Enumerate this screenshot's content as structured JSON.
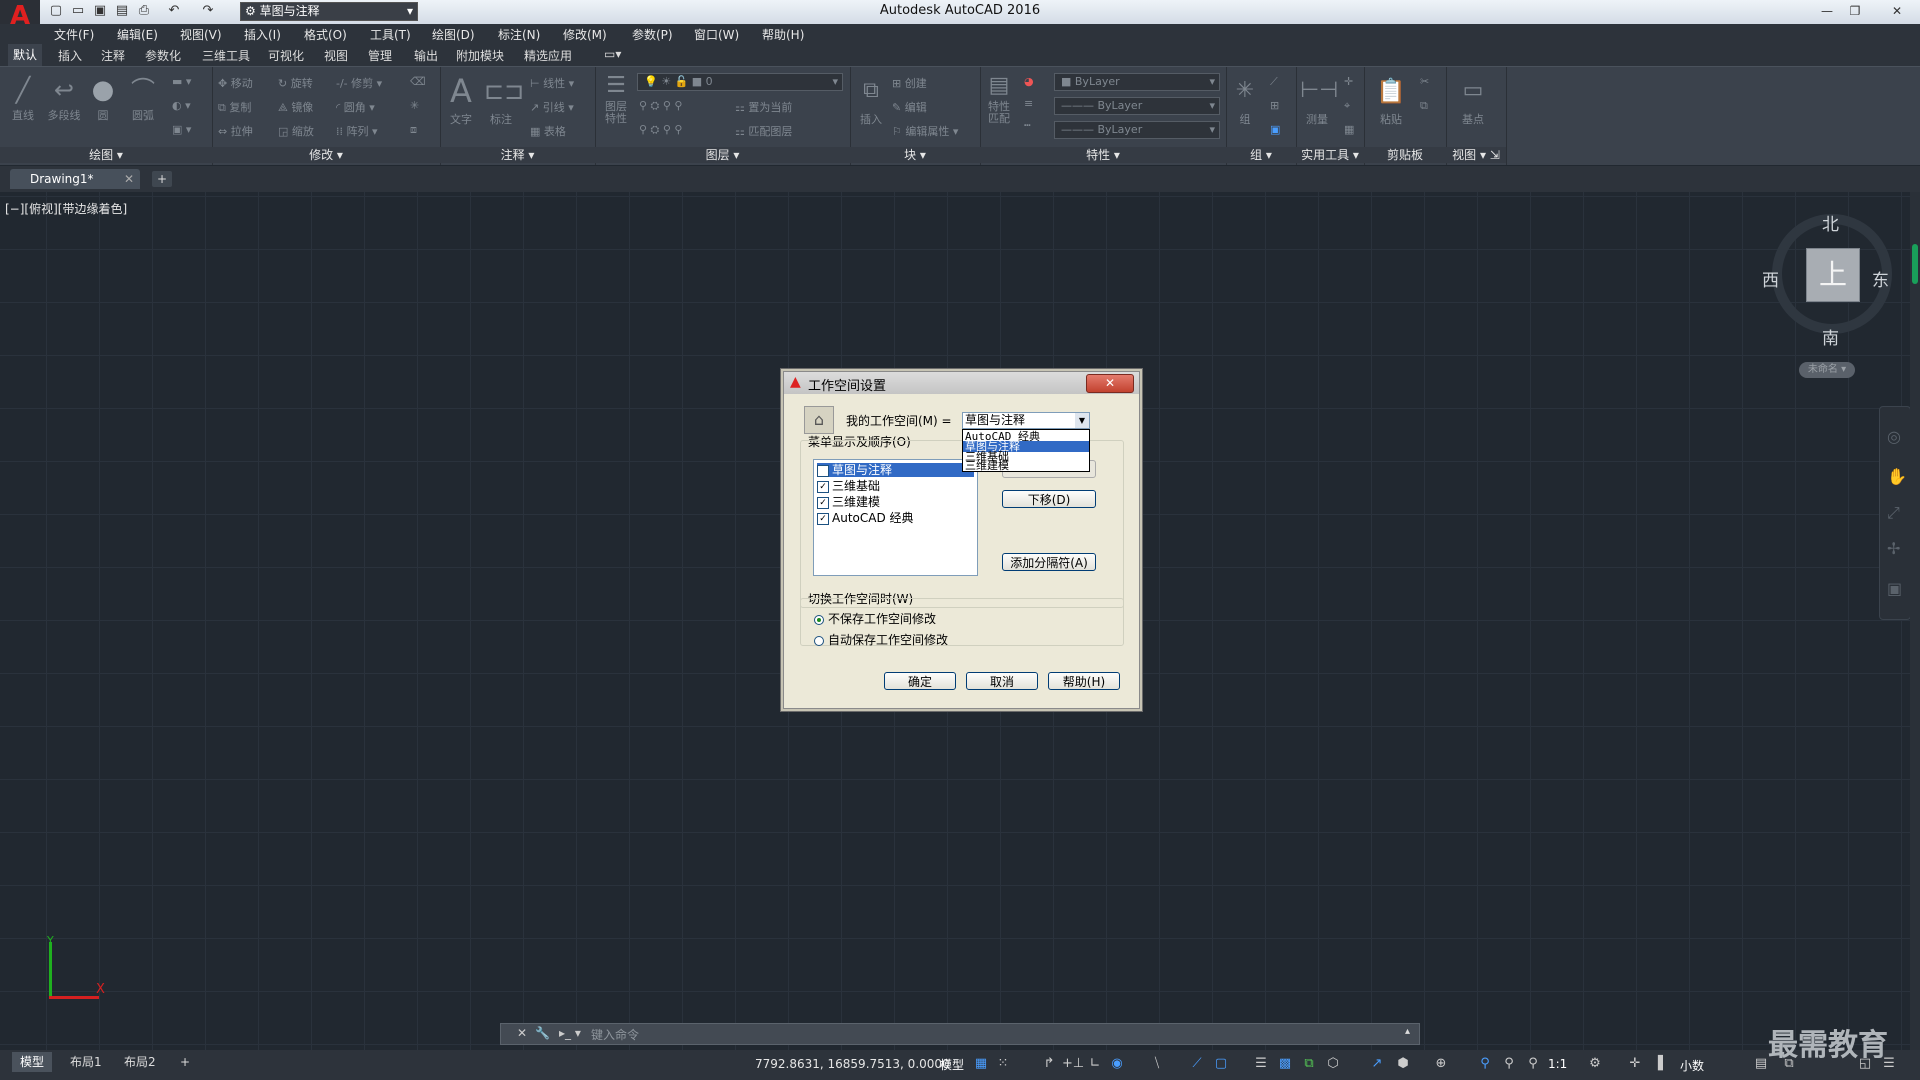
{
  "app": {
    "title": "Autodesk AutoCAD 2016",
    "workspace": "草图与注释",
    "logo_letter": "A"
  },
  "menubar": [
    "文件(F)",
    "编辑(E)",
    "视图(V)",
    "插入(I)",
    "格式(O)",
    "工具(T)",
    "绘图(D)",
    "标注(N)",
    "修改(M)",
    "参数(P)",
    "窗口(W)",
    "帮助(H)"
  ],
  "ribbon_tabs": [
    "默认",
    "插入",
    "注释",
    "参数化",
    "三维工具",
    "可视化",
    "视图",
    "管理",
    "输出",
    "附加模块",
    "精选应用"
  ],
  "ribbon": {
    "panels": [
      "绘图",
      "修改",
      "注释",
      "图层",
      "块",
      "特性",
      "组",
      "实用工具",
      "剪贴板",
      "视图"
    ],
    "draw_tools": [
      "直线",
      "多段线",
      "圆",
      "圆弧"
    ],
    "modify_tools": [
      "移动",
      "旋转",
      "修剪",
      "复制",
      "镜像",
      "圆角",
      "拉伸",
      "缩放",
      "阵列"
    ],
    "annotate_tools": [
      "文字",
      "标注",
      "线性",
      "引线",
      "表格"
    ],
    "layer_value": "0",
    "layer_tools": [
      "图层特性",
      "置为当前",
      "匹配图层"
    ],
    "block_tools": [
      "插入",
      "创建",
      "编辑",
      "编辑属性"
    ],
    "props": [
      "ByLayer",
      "ByLayer",
      "ByLayer"
    ],
    "prop_tool": "特性匹配",
    "group_tool": "组",
    "util_tool": "测量",
    "clip_tool": "粘贴",
    "view_tool": "基点"
  },
  "doc_tab": {
    "name": "Drawing1*"
  },
  "canvas": {
    "view_label": "[−][俯视][带边缘着色]"
  },
  "viewcube": {
    "north": "北",
    "south": "南",
    "east": "东",
    "west": "西",
    "face": "上",
    "wcs": "未命名"
  },
  "ucs": {
    "x": "X",
    "y": "Y"
  },
  "command_line": {
    "placeholder": "键入命令"
  },
  "layout_tabs": [
    "模型",
    "布局1",
    "布局2"
  ],
  "status": {
    "coords": "7792.8631, 16859.7513, 0.0000",
    "mode": "模型",
    "scale": "1:1",
    "units": "小数"
  },
  "watermark": "最需教育",
  "dialog": {
    "title": "工作空间设置",
    "my_workspace_label": "我的工作空间(M) =",
    "my_workspace_value": "草图与注释",
    "dropdown_options": [
      "AutoCAD 经典",
      "草图与注释",
      "三维基础",
      "三维建模"
    ],
    "dropdown_selected_index": 1,
    "menu_order_label": "菜单显示及顺序(O)",
    "menu_items": [
      "草图与注释",
      "三维基础",
      "三维建模",
      "AutoCAD 经典"
    ],
    "move_down": "下移(D)",
    "add_separator": "添加分隔符(A)",
    "switch_label": "切换工作空间时(W)",
    "option_no_save": "不保存工作空间修改",
    "option_auto_save": "自动保存工作空间修改",
    "ok": "确定",
    "cancel": "取消",
    "help": "帮助(H)"
  }
}
